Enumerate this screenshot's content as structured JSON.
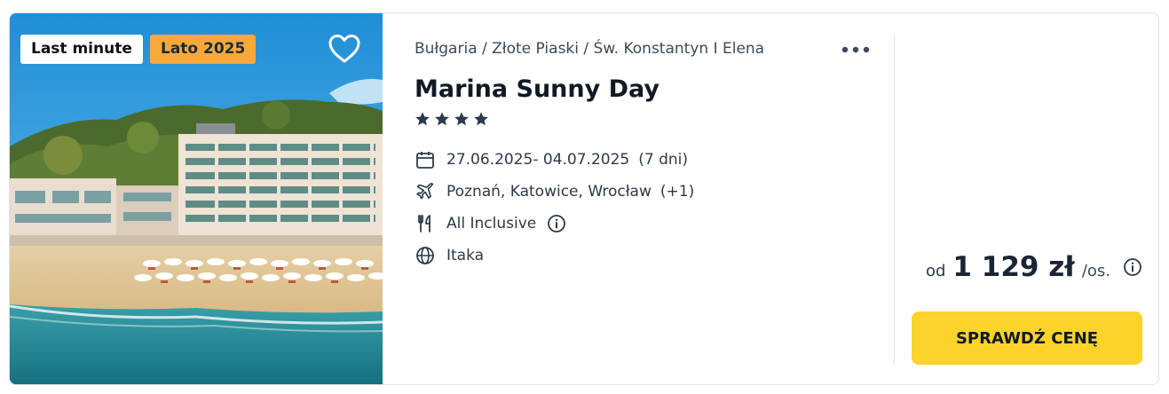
{
  "offer": {
    "badges": [
      "Last minute",
      "Lato 2025"
    ],
    "breadcrumb": "Bułgaria / Złote Piaski / Św. Konstantyn I Elena",
    "hotel_name": "Marina Sunny Day",
    "stars": 4,
    "dates": "27.06.2025- 04.07.2025",
    "duration": "(7 dni)",
    "departures": "Poznań, Katowice, Wrocław",
    "departures_extra": "(+1)",
    "board": "All Inclusive",
    "operator": "Itaka"
  },
  "price": {
    "prefix": "od",
    "amount": "1 129 zł",
    "unit": "/os."
  },
  "cta_label": "SPRAWDŹ CENĘ",
  "colors": {
    "badge_orange": "#f7a93a",
    "cta_yellow": "#fbd32a",
    "star": "#2b3a4e"
  },
  "icons": {
    "favorite": "heart-icon",
    "more": "more-dots-icon",
    "dates": "calendar-icon",
    "departures": "plane-icon",
    "board": "cutlery-icon",
    "operator": "globe-icon",
    "info": "info-icon",
    "rating": "star-icon"
  }
}
